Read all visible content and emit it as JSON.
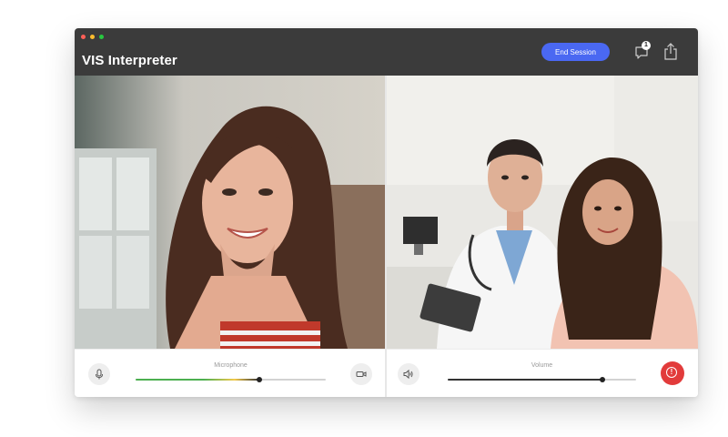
{
  "app": {
    "title": "VIS Interpreter"
  },
  "window_controls": {
    "close_color": "#ff5f57",
    "minimize_color": "#febc2e",
    "maximize_color": "#28c840"
  },
  "toolbar": {
    "end_session_label": "End Session",
    "end_session_color": "#4a68f2",
    "chat_badge_count": "1",
    "chat_icon": "chat-bubble-icon",
    "share_icon": "share-upload-icon"
  },
  "left_panel": {
    "video": "interpreter-video-feed",
    "mic_icon": "microphone-icon",
    "slider_label": "Microphone",
    "slider_level": 0.65,
    "level_colors": [
      "#4caf50",
      "#f2c94c"
    ],
    "camera_icon": "video-camera-icon"
  },
  "right_panel": {
    "video": "doctor-patient-video-feed",
    "speaker_icon": "speaker-icon",
    "slider_label": "Volume",
    "slider_level": 0.82,
    "alert_icon": "alert-icon",
    "alert_color": "#e23b3b"
  }
}
